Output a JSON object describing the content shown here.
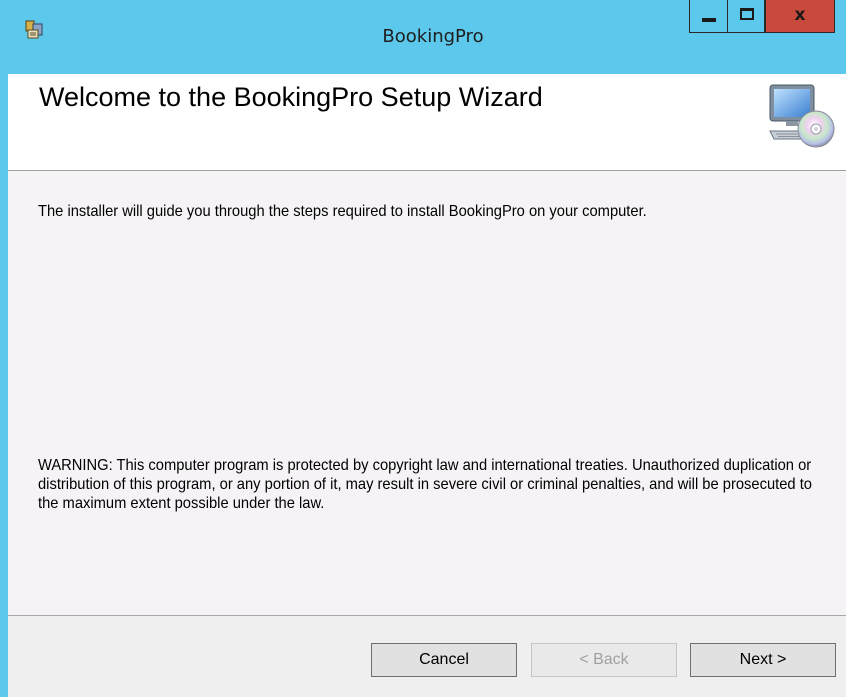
{
  "window": {
    "title": "BookingPro",
    "controls": {
      "minimize_icon": "minimize-icon",
      "maximize_icon": "maximize-icon",
      "close_label": "x"
    }
  },
  "banner": {
    "title": "Welcome to the BookingPro Setup Wizard",
    "icon": "computer-disc-icon"
  },
  "content": {
    "intro": "The installer will guide you through the steps required to install BookingPro on your computer.",
    "warning": "WARNING: This computer program is protected by copyright law and international treaties. Unauthorized duplication or distribution of this program, or any portion of it, may result in severe civil or criminal penalties, and will be prosecuted to the maximum extent possible under the law."
  },
  "buttons": {
    "cancel": "Cancel",
    "back": "< Back",
    "next": "Next >"
  },
  "colors": {
    "titlebar": "#5bc8ec",
    "close_button": "#c9493c",
    "banner_bg": "#ffffff",
    "content_bg": "#f6f3f6"
  }
}
